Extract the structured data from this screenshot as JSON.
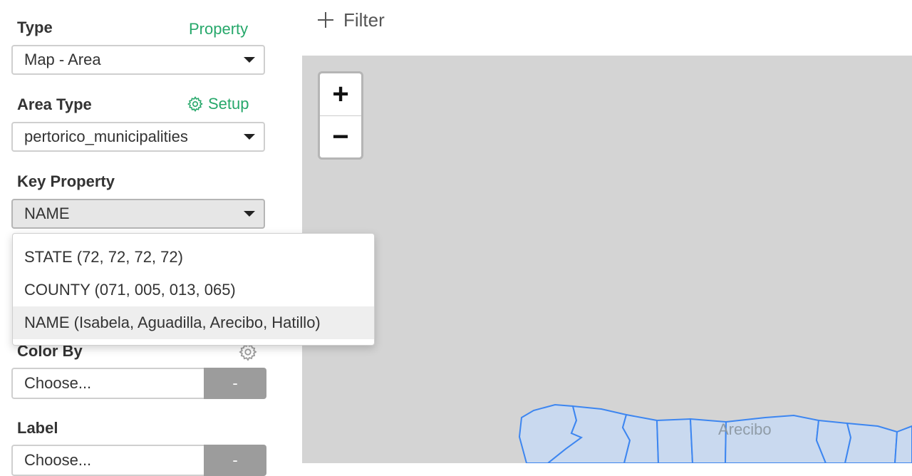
{
  "sidebar": {
    "type": {
      "label": "Type",
      "link": "Property",
      "value": "Map - Area"
    },
    "area_type": {
      "label": "Area Type",
      "link": "Setup",
      "value": "pertorico_municipalities"
    },
    "key_property": {
      "label": "Key Property",
      "value": "NAME"
    },
    "color_by": {
      "label": "Color By",
      "value": "Choose...",
      "button": "-"
    },
    "label_field": {
      "label": "Label",
      "value": "Choose...",
      "button": "-"
    }
  },
  "dropdown": {
    "options": [
      "STATE (72, 72, 72, 72)",
      "COUNTY (071, 005, 013, 065)",
      "NAME (Isabela, Aguadilla, Arecibo, Hatillo)"
    ],
    "selected_index": 2
  },
  "toolbar": {
    "filter_label": "Filter"
  },
  "map": {
    "zoom_in": "+",
    "zoom_out": "−",
    "place_label": "Arecibo"
  },
  "colors": {
    "accent": "#27a86b",
    "map_bg": "#d4d4d4",
    "region_fill": "#c9d9ef",
    "region_stroke": "#3d86f0"
  }
}
